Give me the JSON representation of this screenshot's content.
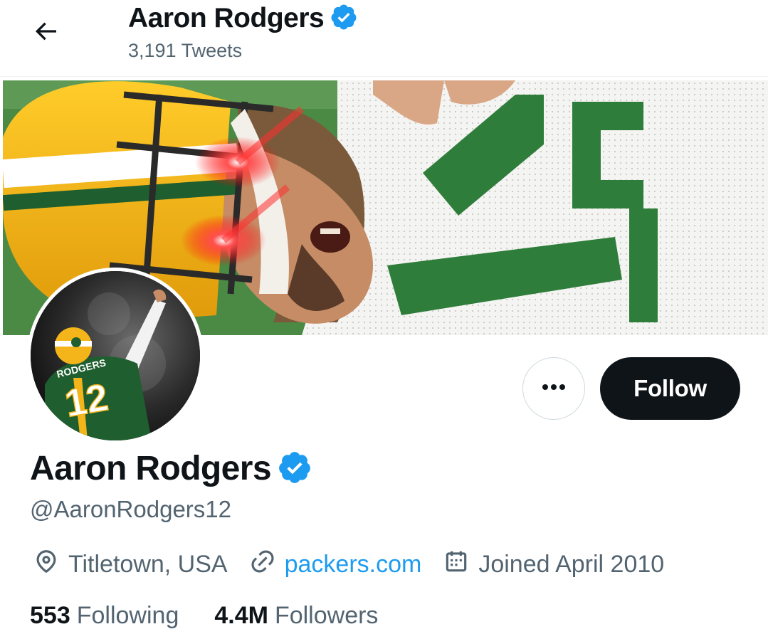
{
  "header": {
    "back_label": "Back",
    "title": "Aaron Rodgers",
    "tweet_count": "3,191 Tweets"
  },
  "profile": {
    "name": "Aaron Rodgers",
    "handle": "@AaronRodgers12",
    "verified": true,
    "location": "Titletown, USA",
    "website": "packers.com",
    "joined": "Joined April 2010",
    "avatar_jersey_name": "RODGERS",
    "avatar_jersey_number": "12"
  },
  "actions": {
    "more_label": "•••",
    "follow_label": "Follow"
  },
  "stats": {
    "following_count": "553",
    "following_label": "Following",
    "followers_count": "4.4M",
    "followers_label": "Followers"
  },
  "colors": {
    "accent": "#1d9bf0",
    "text_primary": "#0f1419",
    "text_secondary": "#536471",
    "packers_green": "#1f5e2e",
    "packers_gold": "#f4b51a"
  },
  "icons": {
    "back": "arrow-left-icon",
    "verified": "verified-badge-icon",
    "location": "location-pin-icon",
    "link": "link-icon",
    "calendar": "calendar-icon",
    "more": "more-dots-icon"
  }
}
